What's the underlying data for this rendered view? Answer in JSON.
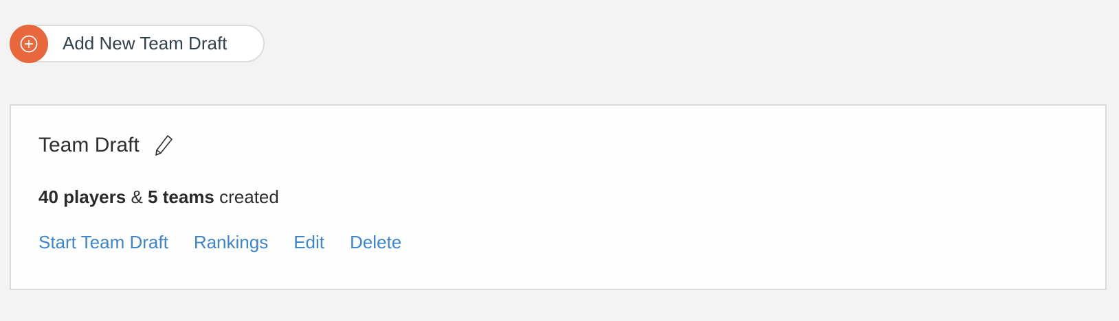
{
  "add_button": {
    "label": "Add New Team Draft",
    "icon": "plus-circle-icon",
    "color": "#e8673c"
  },
  "draft_card": {
    "title": "Team Draft",
    "edit_icon": "pencil-icon",
    "summary": {
      "players": "40 players",
      "separator": "&",
      "teams": "5 teams",
      "suffix": "created"
    },
    "actions": [
      {
        "label": "Start Team Draft"
      },
      {
        "label": "Rankings"
      },
      {
        "label": "Edit"
      },
      {
        "label": "Delete"
      }
    ],
    "link_color": "#3d86cb"
  }
}
